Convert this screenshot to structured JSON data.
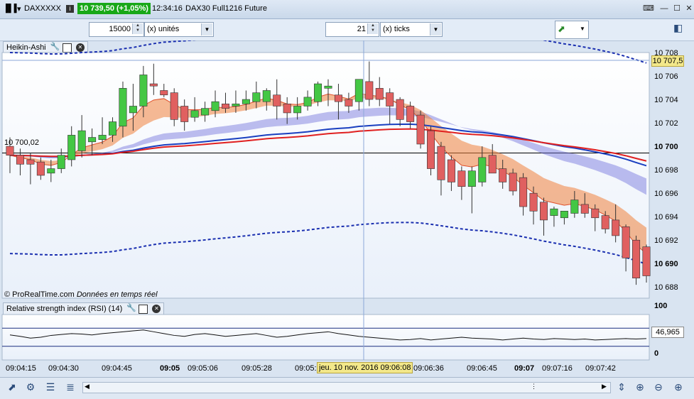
{
  "titlebar": {
    "symbol": "DAXXXXX",
    "price": "10 739,50 (+1,05%)",
    "time": "12:34:16",
    "instrument": "DAX30 Full1216 Future"
  },
  "toolbar": {
    "units_value": "15000",
    "units_label": "(x) unités",
    "ticks_value": "21",
    "ticks_label": "(x) ticks"
  },
  "main_panel": {
    "title": "Heikin-Ashi",
    "watermark": "© ProRealTime.com",
    "watermark_note": "Données en temps réel",
    "level_label": "10 700,02",
    "current_price": "10 707,5",
    "y_labels": [
      "10 708",
      "10 706",
      "10 704",
      "10 702",
      "10 700",
      "10 698",
      "10 696",
      "10 694",
      "10 692",
      "10 690",
      "10 688"
    ]
  },
  "rsi_panel": {
    "title": "Relative strength index (RSI) (14)",
    "y_top": "100",
    "y_bottom": "0",
    "current": "46,965"
  },
  "time_axis": {
    "labels": [
      "09:04:15",
      "09:04:30",
      "09:04:45",
      "09:05",
      "09:05:06",
      "09:05:28",
      "09:05:",
      "09:06:36",
      "09:06:45",
      "09:07",
      "09:07:16",
      "09:07:42"
    ],
    "cursor": "jeu. 10 nov. 2016 09:06:08"
  },
  "chart_data": {
    "type": "candlestick",
    "ylim": [
      10687,
      10709
    ],
    "candles": [
      {
        "o": 10700.6,
        "h": 10701.4,
        "l": 10698.2,
        "c": 10699.8
      },
      {
        "o": 10699.8,
        "h": 10700.4,
        "l": 10698.0,
        "c": 10699.0
      },
      {
        "o": 10699.4,
        "h": 10700.0,
        "l": 10697.2,
        "c": 10699.0
      },
      {
        "o": 10699.2,
        "h": 10699.6,
        "l": 10697.6,
        "c": 10698.0
      },
      {
        "o": 10698.2,
        "h": 10699.4,
        "l": 10697.4,
        "c": 10698.6
      },
      {
        "o": 10698.6,
        "h": 10700.4,
        "l": 10698.2,
        "c": 10699.8
      },
      {
        "o": 10699.4,
        "h": 10702.4,
        "l": 10698.8,
        "c": 10701.6
      },
      {
        "o": 10700.2,
        "h": 10703.4,
        "l": 10699.6,
        "c": 10702.0
      },
      {
        "o": 10701.0,
        "h": 10702.2,
        "l": 10699.8,
        "c": 10701.4
      },
      {
        "o": 10701.2,
        "h": 10703.2,
        "l": 10700.8,
        "c": 10701.6
      },
      {
        "o": 10701.6,
        "h": 10703.2,
        "l": 10701.0,
        "c": 10702.8
      },
      {
        "o": 10702.4,
        "h": 10706.4,
        "l": 10701.4,
        "c": 10705.8
      },
      {
        "o": 10703.6,
        "h": 10706.2,
        "l": 10702.0,
        "c": 10704.2
      },
      {
        "o": 10704.2,
        "h": 10707.8,
        "l": 10703.2,
        "c": 10707.0
      },
      {
        "o": 10706.2,
        "h": 10708.0,
        "l": 10705.2,
        "c": 10706.0
      },
      {
        "o": 10705.6,
        "h": 10706.2,
        "l": 10705.0,
        "c": 10705.2
      },
      {
        "o": 10705.4,
        "h": 10705.8,
        "l": 10702.4,
        "c": 10703.0
      },
      {
        "o": 10704.2,
        "h": 10704.8,
        "l": 10702.0,
        "c": 10702.8
      },
      {
        "o": 10703.2,
        "h": 10705.0,
        "l": 10702.8,
        "c": 10703.8
      },
      {
        "o": 10703.4,
        "h": 10704.6,
        "l": 10702.8,
        "c": 10704.0
      },
      {
        "o": 10703.8,
        "h": 10705.6,
        "l": 10703.2,
        "c": 10704.6
      },
      {
        "o": 10704.4,
        "h": 10705.4,
        "l": 10703.6,
        "c": 10704.0
      },
      {
        "o": 10704.2,
        "h": 10705.6,
        "l": 10703.6,
        "c": 10704.4
      },
      {
        "o": 10704.4,
        "h": 10705.6,
        "l": 10703.8,
        "c": 10704.8
      },
      {
        "o": 10704.6,
        "h": 10706.4,
        "l": 10704.0,
        "c": 10705.4
      },
      {
        "o": 10704.6,
        "h": 10705.8,
        "l": 10703.8,
        "c": 10705.6
      },
      {
        "o": 10705.2,
        "h": 10706.6,
        "l": 10703.0,
        "c": 10704.2
      },
      {
        "o": 10704.4,
        "h": 10705.0,
        "l": 10702.6,
        "c": 10703.6
      },
      {
        "o": 10703.6,
        "h": 10705.0,
        "l": 10703.0,
        "c": 10704.2
      },
      {
        "o": 10704.2,
        "h": 10705.6,
        "l": 10703.8,
        "c": 10705.0
      },
      {
        "o": 10704.6,
        "h": 10706.4,
        "l": 10704.2,
        "c": 10706.2
      },
      {
        "o": 10705.8,
        "h": 10706.6,
        "l": 10704.2,
        "c": 10706.0
      },
      {
        "o": 10705.2,
        "h": 10706.2,
        "l": 10703.0,
        "c": 10704.6
      },
      {
        "o": 10704.8,
        "h": 10705.4,
        "l": 10703.6,
        "c": 10704.2
      },
      {
        "o": 10704.6,
        "h": 10706.6,
        "l": 10703.8,
        "c": 10706.6
      },
      {
        "o": 10706.4,
        "h": 10708.2,
        "l": 10704.2,
        "c": 10704.8
      },
      {
        "o": 10705.8,
        "h": 10706.8,
        "l": 10704.2,
        "c": 10704.8
      },
      {
        "o": 10705.4,
        "h": 10705.8,
        "l": 10702.6,
        "c": 10704.2
      },
      {
        "o": 10704.8,
        "h": 10705.0,
        "l": 10702.4,
        "c": 10703.0
      },
      {
        "o": 10704.2,
        "h": 10704.6,
        "l": 10702.2,
        "c": 10702.8
      },
      {
        "o": 10703.4,
        "h": 10703.8,
        "l": 10700.4,
        "c": 10700.8
      },
      {
        "o": 10702.0,
        "h": 10702.4,
        "l": 10698.0,
        "c": 10698.6
      },
      {
        "o": 10700.6,
        "h": 10701.0,
        "l": 10696.2,
        "c": 10697.6
      },
      {
        "o": 10699.4,
        "h": 10699.8,
        "l": 10696.6,
        "c": 10697.4
      },
      {
        "o": 10698.4,
        "h": 10698.8,
        "l": 10695.8,
        "c": 10697.0
      },
      {
        "o": 10697.0,
        "h": 10698.8,
        "l": 10694.6,
        "c": 10698.4
      },
      {
        "o": 10697.4,
        "h": 10700.6,
        "l": 10697.0,
        "c": 10699.6
      },
      {
        "o": 10699.8,
        "h": 10700.8,
        "l": 10698.6,
        "c": 10698.2
      },
      {
        "o": 10698.6,
        "h": 10699.4,
        "l": 10696.8,
        "c": 10697.4
      },
      {
        "o": 10698.2,
        "h": 10698.6,
        "l": 10696.2,
        "c": 10696.6
      },
      {
        "o": 10697.8,
        "h": 10698.2,
        "l": 10694.4,
        "c": 10695.2
      },
      {
        "o": 10696.4,
        "h": 10697.0,
        "l": 10693.6,
        "c": 10694.8
      },
      {
        "o": 10695.6,
        "h": 10696.0,
        "l": 10692.6,
        "c": 10694.0
      },
      {
        "o": 10694.4,
        "h": 10695.2,
        "l": 10693.4,
        "c": 10695.0
      },
      {
        "o": 10694.2,
        "h": 10694.8,
        "l": 10693.6,
        "c": 10694.8
      },
      {
        "o": 10694.6,
        "h": 10696.6,
        "l": 10694.2,
        "c": 10695.8
      },
      {
        "o": 10695.4,
        "h": 10696.4,
        "l": 10694.2,
        "c": 10694.6
      },
      {
        "o": 10695.0,
        "h": 10695.4,
        "l": 10693.0,
        "c": 10694.2
      },
      {
        "o": 10694.4,
        "h": 10694.8,
        "l": 10692.8,
        "c": 10693.2
      },
      {
        "o": 10694.0,
        "h": 10695.4,
        "l": 10692.0,
        "c": 10692.6
      },
      {
        "o": 10693.4,
        "h": 10693.6,
        "l": 10689.4,
        "c": 10690.6
      },
      {
        "o": 10692.2,
        "h": 10692.6,
        "l": 10688.2,
        "c": 10688.8
      },
      {
        "o": 10691.6,
        "h": 10691.8,
        "l": 10688.4,
        "c": 10689.0
      }
    ],
    "rsi_values": [
      55,
      52,
      48,
      50,
      54,
      56,
      58,
      57,
      55,
      58,
      60,
      62,
      64,
      66,
      62,
      58,
      54,
      52,
      56,
      58,
      55,
      52,
      54,
      56,
      58,
      54,
      50,
      52,
      55,
      58,
      60,
      62,
      58,
      55,
      52,
      50,
      48,
      46,
      44,
      45,
      47,
      44,
      46,
      48,
      50,
      48,
      47,
      46,
      44,
      46,
      48,
      46,
      45,
      47,
      46,
      45,
      46,
      44,
      45,
      46,
      47,
      46,
      47
    ],
    "rsi_levels": [
      70,
      30
    ]
  }
}
